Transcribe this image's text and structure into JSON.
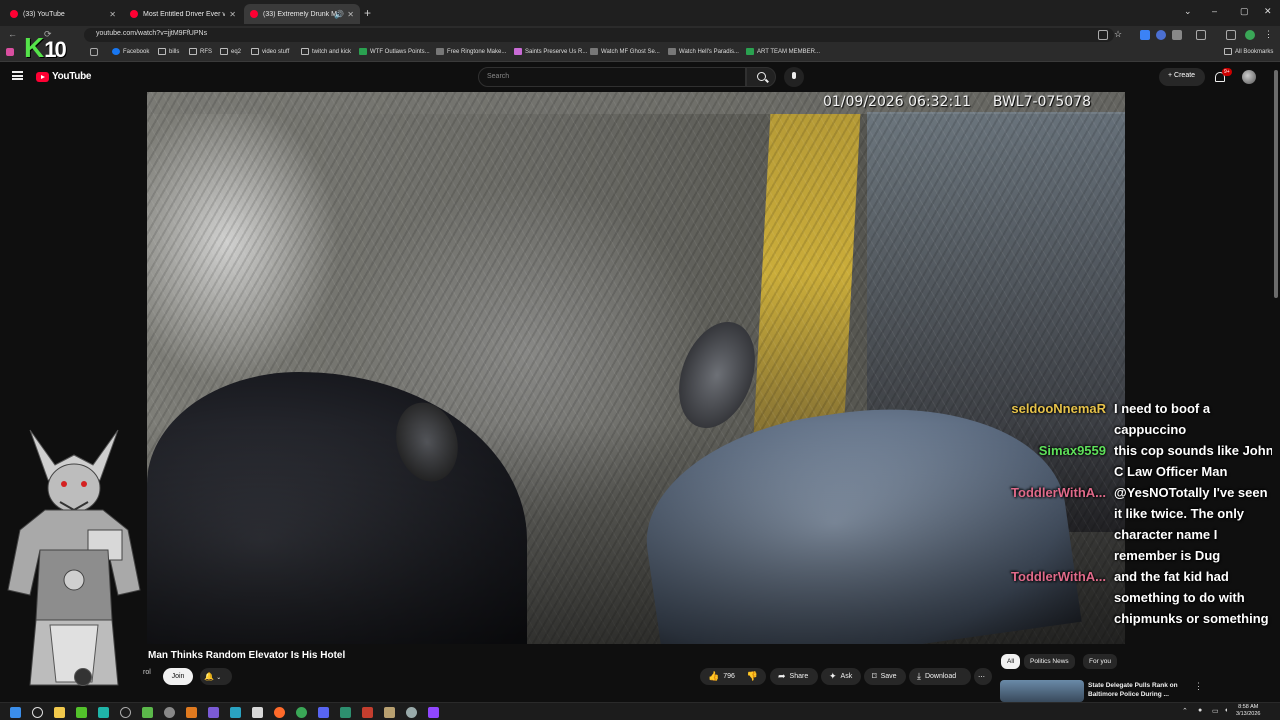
{
  "browser": {
    "tabs": [
      {
        "label": "(33) YouTube",
        "active": false
      },
      {
        "label": "Most Entitled Driver Ever vs Bo",
        "active": false
      },
      {
        "label": "(33) Extremely Drunk Man",
        "active": true
      }
    ],
    "new_tab": "+",
    "window_controls": [
      "⌄",
      "–",
      "▢",
      "✕"
    ],
    "url": "youtube.com/watch?v=jjtM9FfUPNs",
    "bookmarks": [
      "Facebook",
      "bills",
      "RFS",
      "eq2",
      "video stuff",
      "twitch and kick",
      "WTF Outlaws Points...",
      "Free Ringtone Make...",
      "Saints Preserve Us R...",
      "Watch MF Ghost Se...",
      "Watch Hell's Paradis...",
      "ART TEAM MEMBER..."
    ],
    "all_bookmarks": "All Bookmarks"
  },
  "stream_overlay": {
    "badge_letter": "K",
    "badge_number": "10"
  },
  "youtube": {
    "logo_text": "YouTube",
    "search_placeholder": "Search",
    "create_label": "Create",
    "notif_count": "9+"
  },
  "video": {
    "bodycam_timestamp": "01/09/2026 06:32:11",
    "bodycam_id": "BWL7-075078",
    "title": "Man Thinks Random Elevator Is His Hotel",
    "channel_abbr": "rol",
    "join_label": "Join",
    "like_count": "796",
    "share_label": "Share",
    "ask_label": "Ask",
    "save_label": "Save",
    "download_label": "Download",
    "more_label": "⋯"
  },
  "chat": [
    {
      "user": "seldooNnemaR",
      "color": "#e6c24a",
      "text": "I need to boof a cappuccino"
    },
    {
      "user": "Simax9559",
      "color": "#5ee05a",
      "text": "this cop sounds like John C Law Officer Man"
    },
    {
      "user": "ToddlerWithA...",
      "color": "#e06a8a",
      "text": "@YesNOTotally I've seen it like twice. The only character name I remember is Dug"
    },
    {
      "user": "ToddlerWithA...",
      "color": "#e06a8a",
      "text": "and the fat kid had something to do with chipmunks or something"
    }
  ],
  "related": {
    "chips": [
      {
        "label": "All",
        "selected": true
      },
      {
        "label": "Politics News",
        "selected": false
      },
      {
        "label": "For you",
        "selected": false
      }
    ],
    "first_title": "State Delegate Pulls Rank on Baltimore Police During ..."
  },
  "taskbar": {
    "time": "8:58 AM",
    "date": "3/13/2026"
  },
  "colors": {
    "youtube_red": "#ff0033",
    "page_bg": "#0f0f0f",
    "kick_green": "#55e34a"
  }
}
